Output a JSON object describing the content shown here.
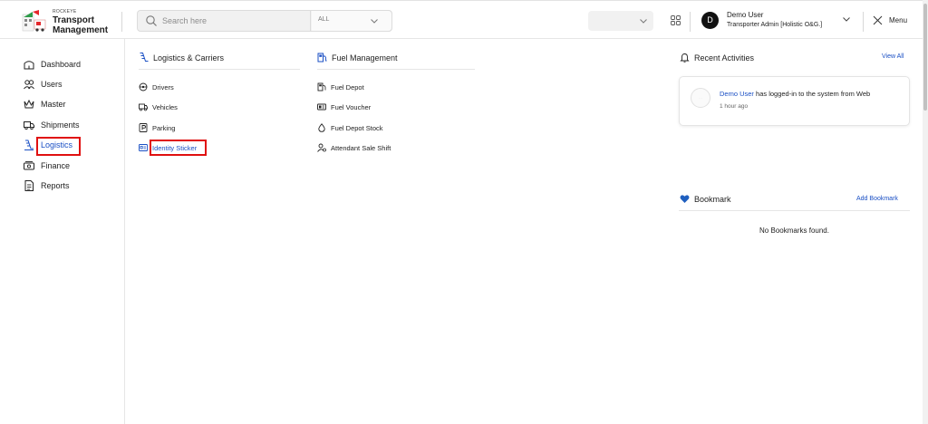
{
  "header": {
    "logo": {
      "brand": "ROCKEYE",
      "line1": "Transport",
      "line2": "Management"
    },
    "search": {
      "placeholder": "Search here",
      "scope": "ALL"
    },
    "user": {
      "initial": "D",
      "name": "Demo User",
      "role": "Transporter Admin [Holistic O&G.]"
    },
    "menu_label": "Menu"
  },
  "sidebar": {
    "items": [
      {
        "label": "Dashboard",
        "icon": "home-icon"
      },
      {
        "label": "Users",
        "icon": "users-icon"
      },
      {
        "label": "Master",
        "icon": "crown-icon"
      },
      {
        "label": "Shipments",
        "icon": "truck-icon"
      },
      {
        "label": "Logistics",
        "icon": "logistics-icon",
        "active": true
      },
      {
        "label": "Finance",
        "icon": "finance-icon"
      },
      {
        "label": "Reports",
        "icon": "reports-icon"
      }
    ]
  },
  "sections": [
    {
      "title": "Logistics & Carriers",
      "icon": "logistics-icon",
      "items": [
        {
          "label": "Drivers",
          "icon": "driver-icon"
        },
        {
          "label": "Vehicles",
          "icon": "truck-icon"
        },
        {
          "label": "Parking",
          "icon": "parking-icon"
        },
        {
          "label": "Identity Sticker",
          "icon": "id-card-icon",
          "active": true
        }
      ]
    },
    {
      "title": "Fuel Management",
      "icon": "fuel-pump-icon",
      "items": [
        {
          "label": "Fuel Depot",
          "icon": "fuel-depot-icon"
        },
        {
          "label": "Fuel Voucher",
          "icon": "voucher-icon"
        },
        {
          "label": "Fuel Depot Stock",
          "icon": "drop-icon"
        },
        {
          "label": "Attendant Sale Shift",
          "icon": "attendant-icon"
        }
      ]
    }
  ],
  "recent_activities": {
    "title": "Recent Activities",
    "action": "View All",
    "items": [
      {
        "user": "Demo User",
        "text": "has logged-in to the system from Web",
        "time": "1 hour ago"
      }
    ]
  },
  "bookmark": {
    "title": "Bookmark",
    "action": "Add Bookmark",
    "empty_text": "No Bookmarks found."
  },
  "colors": {
    "accent": "#1a4fc4",
    "highlight": "#e01010",
    "bookmark_heart": "#1f5fbf"
  }
}
